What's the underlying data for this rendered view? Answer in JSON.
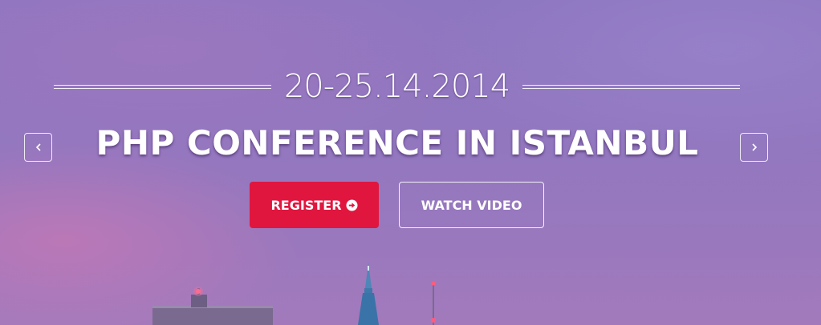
{
  "hero": {
    "date": "20-25.14.2014",
    "title": "PHP CONFERENCE IN ISTANBUL"
  },
  "buttons": {
    "register_label": "REGISTER",
    "watch_label": "WATCH VIDEO"
  },
  "icons": {
    "prev": "chevron-left-icon",
    "next": "chevron-right-icon",
    "register": "circle-arrow-right-icon"
  },
  "colors": {
    "register_button": "#e0163f",
    "text": "#ffffff"
  }
}
